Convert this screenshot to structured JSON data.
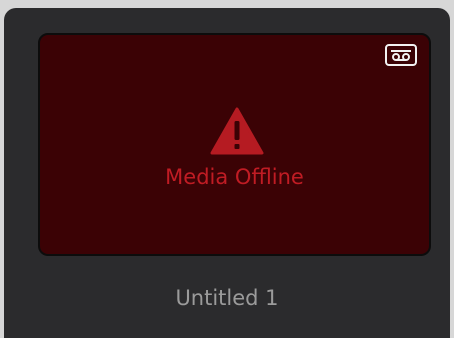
{
  "clip": {
    "status_text": "Media Offline",
    "name": "Untitled 1",
    "badge_icon": "tape-icon",
    "status_icon": "warning-triangle-icon"
  },
  "colors": {
    "card_background": "#2b2b2d",
    "thumbnail_background": "#3b0205",
    "offline_red": "#c01c24",
    "name_text": "#9b9b9b"
  }
}
